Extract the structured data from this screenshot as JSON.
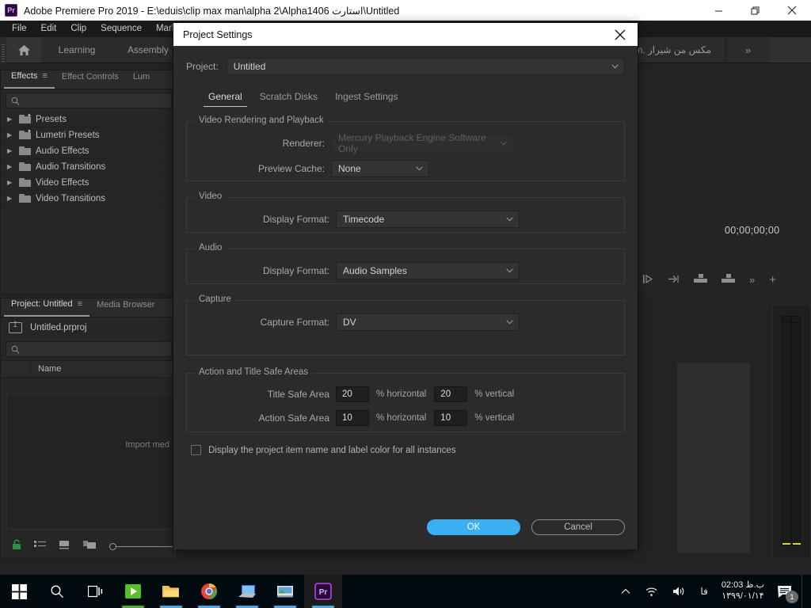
{
  "os": {
    "titlebar": {
      "app_badge": "Pr",
      "title": "Adobe Premiere Pro 2019 - E:\\eduis\\clip max man\\alpha 2\\Alpha1406 استارت\\Untitled",
      "minimize": "minimize-icon",
      "restore": "restore-icon",
      "close": "close-icon"
    },
    "taskbar": {
      "apps": [
        {
          "name": "start-button",
          "label": "Windows"
        },
        {
          "name": "search-button",
          "label": "Search"
        },
        {
          "name": "task-view-button",
          "label": "Task View"
        },
        {
          "name": "taskbar-app-edius",
          "label": "EDIUS"
        },
        {
          "name": "taskbar-app-explorer",
          "label": "File Explorer"
        },
        {
          "name": "taskbar-app-chrome",
          "label": "Google Chrome"
        },
        {
          "name": "taskbar-app-media",
          "label": "Media Player"
        },
        {
          "name": "taskbar-app-photo",
          "label": "Photo Viewer"
        },
        {
          "name": "taskbar-app-premiere",
          "label": "Adobe Premiere Pro"
        }
      ],
      "tray": {
        "chevron": "˄",
        "network": "wifi-icon",
        "volume": "volume-icon",
        "language": "فا",
        "time": "02:03 ب.ظ",
        "date": "۱۳۹۹/۰۱/۱۴",
        "notification_count": "1"
      }
    }
  },
  "menubar": {
    "items": [
      "File",
      "Edit",
      "Clip",
      "Sequence",
      "Markers"
    ]
  },
  "workspace": {
    "home_icon": "home-icon",
    "tabs": [
      "Learning",
      "Assembly"
    ],
    "rtl_tab": "مکس من شیراز .com",
    "overflow": "»"
  },
  "effects_panel": {
    "tabs": [
      {
        "label": "Effects",
        "active": true,
        "menu": "≡"
      },
      {
        "label": "Effect Controls",
        "active": false
      },
      {
        "label": "Lum",
        "active": false
      }
    ],
    "search_placeholder": "",
    "items": [
      {
        "label": "Presets",
        "starred": true
      },
      {
        "label": "Lumetri Presets",
        "starred": true
      },
      {
        "label": "Audio Effects",
        "starred": false
      },
      {
        "label": "Audio Transitions",
        "starred": false
      },
      {
        "label": "Video Effects",
        "starred": false
      },
      {
        "label": "Video Transitions",
        "starred": false
      }
    ]
  },
  "project_panel": {
    "tabs": [
      {
        "label": "Project: Untitled",
        "active": true,
        "menu": "≡"
      },
      {
        "label": "Media Browser",
        "active": false
      }
    ],
    "project_file": "Untitled.prproj",
    "search_placeholder": "",
    "column_header": "Name",
    "empty_hint": "Import med",
    "footer_icons": [
      "lock-icon",
      "list-view-icon",
      "icon-view-icon",
      "freeform-view-icon",
      "zoom-slider"
    ]
  },
  "monitor": {
    "timecode": "00;00;00;00",
    "tools": [
      "mark-in-icon",
      "mark-out-icon",
      "insert-icon",
      "overwrite-icon",
      "more-icon",
      "add-icon"
    ]
  },
  "dialog": {
    "title": "Project Settings",
    "close_icon": "close-icon",
    "project_label": "Project:",
    "project_value": "Untitled",
    "tabs": [
      {
        "label": "General",
        "active": true
      },
      {
        "label": "Scratch Disks",
        "active": false
      },
      {
        "label": "Ingest Settings",
        "active": false
      }
    ],
    "video_rendering": {
      "legend": "Video Rendering and Playback",
      "renderer_label": "Renderer:",
      "renderer_value": "Mercury Playback Engine Software Only",
      "renderer_disabled": true,
      "preview_cache_label": "Preview Cache:",
      "preview_cache_value": "None"
    },
    "video": {
      "legend": "Video",
      "display_format_label": "Display Format:",
      "display_format_value": "Timecode"
    },
    "audio": {
      "legend": "Audio",
      "display_format_label": "Display Format:",
      "display_format_value": "Audio Samples"
    },
    "capture": {
      "legend": "Capture",
      "capture_format_label": "Capture Format:",
      "capture_format_value": "DV"
    },
    "safe_areas": {
      "legend": "Action and Title Safe Areas",
      "title_safe_label": "Title Safe Area",
      "title_safe_h": "20",
      "title_safe_v": "20",
      "action_safe_label": "Action Safe Area",
      "action_safe_h": "10",
      "action_safe_v": "10",
      "unit_horizontal": "% horizontal",
      "unit_vertical": "% vertical"
    },
    "checkbox_label": "Display the project item name and label color for all instances",
    "checkbox_checked": false,
    "ok_label": "OK",
    "cancel_label": "Cancel",
    "accent_color": "#3ab0f3"
  }
}
